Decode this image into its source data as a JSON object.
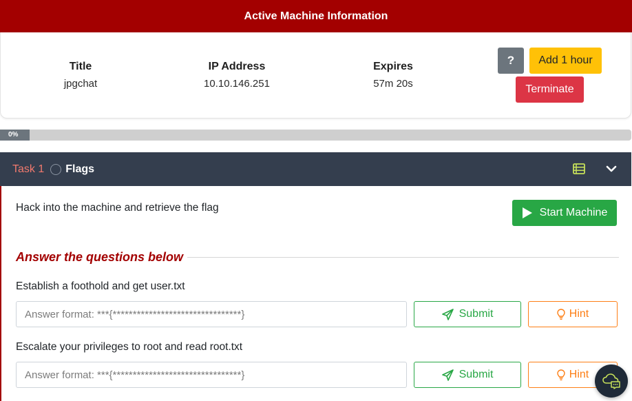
{
  "machine": {
    "header": "Active Machine Information",
    "title_label": "Title",
    "title_value": "jpgchat",
    "ip_label": "IP Address",
    "ip_value": "10.10.146.251",
    "expires_label": "Expires",
    "expires_value": "57m 20s",
    "help_label": "?",
    "add_hour_label": "Add 1 hour",
    "terminate_label": "Terminate"
  },
  "progress": {
    "label": "0%",
    "fraction": 0.0
  },
  "task": {
    "number_label": "Task 1",
    "title": "Flags",
    "description": "Hack into the machine and retrieve the flag",
    "start_machine_label": "Start Machine",
    "answer_heading": "Answer the questions below",
    "questions": [
      {
        "text": "Establish a foothold and get user.txt",
        "placeholder": "Answer format: ***{********************************}",
        "submit_label": "Submit",
        "hint_label": "Hint"
      },
      {
        "text": "Escalate your privileges to root and read root.txt",
        "placeholder": "Answer format: ***{********************************}",
        "submit_label": "Submit",
        "hint_label": "Hint"
      }
    ]
  },
  "icons": {
    "help": "question-icon",
    "task_status": "circle-icon",
    "task_list": "list-icon",
    "collapse": "chevron-down-icon",
    "start": "play-icon",
    "submit": "paper-plane-icon",
    "hint": "lightbulb-icon",
    "chat": "chat-cloud-icon"
  },
  "colors": {
    "brand_red": "#a30000",
    "task_header_bg": "#343e4e",
    "success_green": "#28a745",
    "hint_orange": "#fd7e14",
    "warning_yellow": "#ffc107",
    "danger_red": "#dc3545"
  }
}
